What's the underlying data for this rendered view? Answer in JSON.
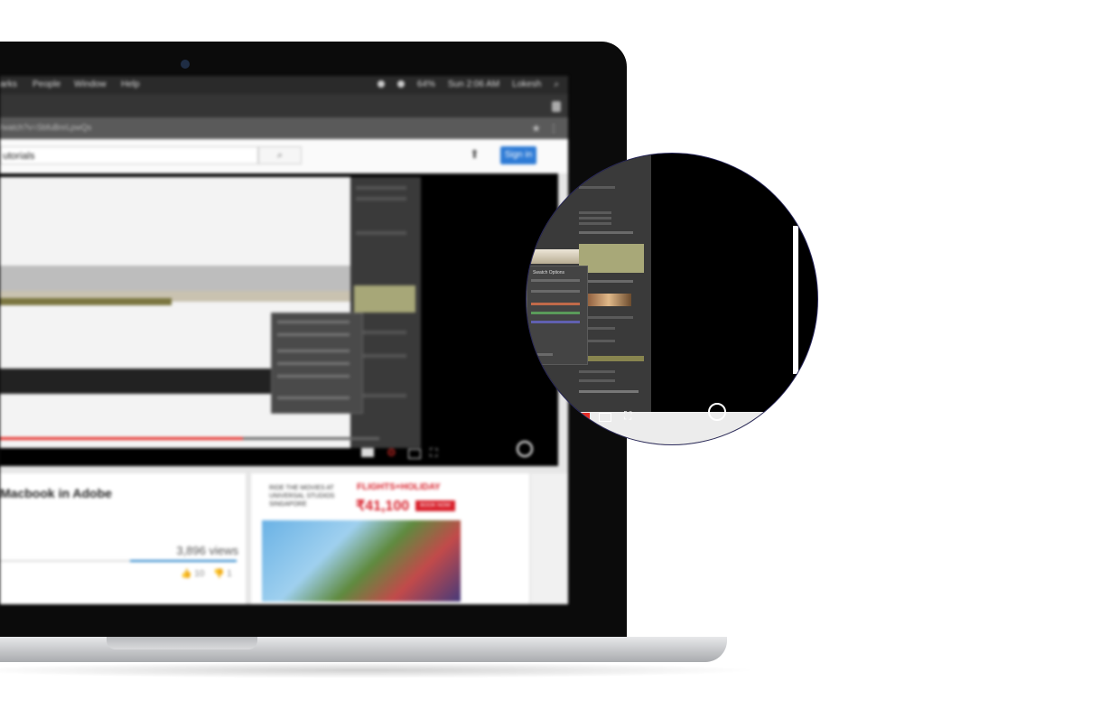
{
  "menubar": {
    "items": [
      "arks",
      "People",
      "Window",
      "Help"
    ],
    "battery": "64%",
    "clock": "Sun 2:06 AM",
    "user": "Lokesh"
  },
  "browser": {
    "url": "/watch?v=SbfuBnrLpwQs"
  },
  "youtube": {
    "search_value": "utorials",
    "search_icon": "search-icon",
    "signin_label": "Sign in"
  },
  "video": {
    "title": "Macbook in Adobe",
    "views": "3,896 views",
    "likes": "10",
    "dislikes": "1",
    "progress": 0.64
  },
  "ad": {
    "line1": "RIDE THE MOVIES AT UNIVERSAL STUDIOS SINGAPORE",
    "brand": "FLIGHTS+HOLIDAY",
    "price": "₹41,100",
    "cta": "BOOK NOW"
  },
  "magnifier": {
    "dialog_title": "Swatch Options"
  },
  "colors": {
    "youtube_red": "#e52d27",
    "signin_blue": "#2e7bd6",
    "swatch_olive": "#a8a878"
  }
}
